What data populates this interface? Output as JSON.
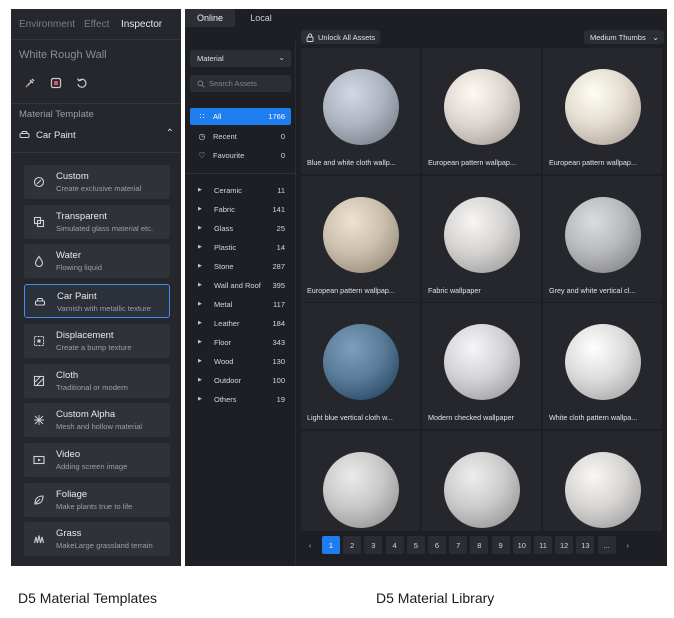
{
  "left_panel": {
    "tabs": [
      "Environment",
      "Effect",
      "Inspector"
    ],
    "active_tab": "Inspector",
    "material_name": "White Rough Wall",
    "section_label": "Material Template",
    "dropdown_value": "Car Paint",
    "templates": [
      {
        "title": "Custom",
        "subtitle": "Create exclusive material",
        "icon": "custom-material-icon"
      },
      {
        "title": "Transparent",
        "subtitle": "Simulated glass material etc.",
        "icon": "transparent-icon"
      },
      {
        "title": "Water",
        "subtitle": "Flowing liquid",
        "icon": "water-drop-icon"
      },
      {
        "title": "Car Paint",
        "subtitle": "Varnish with metallic texture",
        "icon": "car-icon",
        "selected": true
      },
      {
        "title": "Displacement",
        "subtitle": "Create a bump texture",
        "icon": "displacement-icon"
      },
      {
        "title": "Cloth",
        "subtitle": "Traditional or modern",
        "icon": "cloth-icon"
      },
      {
        "title": "Custom Alpha",
        "subtitle": "Mesh and hollow material",
        "icon": "alpha-icon"
      },
      {
        "title": "Video",
        "subtitle": "Adding screen image",
        "icon": "film-icon"
      },
      {
        "title": "Foliage",
        "subtitle": "Make plants true to life",
        "icon": "leaf-icon"
      },
      {
        "title": "Grass",
        "subtitle": "MakeLarge grassland terrain",
        "icon": "grass-icon"
      }
    ]
  },
  "right_panel": {
    "tabs": [
      "Online",
      "Local"
    ],
    "active_tab": "Online",
    "unlock_label": "Unlock All Assets",
    "thumb_size": "Medium Thumbs",
    "sidebar_dropdown": "Material",
    "search_placeholder": "Search Assets",
    "nav": [
      {
        "label": "All",
        "count": "1766",
        "icon": "grid-icon",
        "active": true
      },
      {
        "label": "Recent",
        "count": "0",
        "icon": "clock-icon"
      },
      {
        "label": "Favourite",
        "count": "0",
        "icon": "heart-icon"
      }
    ],
    "categories": [
      {
        "label": "Ceramic",
        "count": "11"
      },
      {
        "label": "Fabric",
        "count": "141"
      },
      {
        "label": "Glass",
        "count": "25"
      },
      {
        "label": "Plastic",
        "count": "14"
      },
      {
        "label": "Stone",
        "count": "287"
      },
      {
        "label": "Wall and Roof",
        "count": "395"
      },
      {
        "label": "Metal",
        "count": "117"
      },
      {
        "label": "Leather",
        "count": "184"
      },
      {
        "label": "Floor",
        "count": "343"
      },
      {
        "label": "Wood",
        "count": "130"
      },
      {
        "label": "Outdoor",
        "count": "100"
      },
      {
        "label": "Others",
        "count": "19"
      }
    ],
    "assets": [
      {
        "name": "Blue and white cloth wallp...",
        "color": "#aeb4c0"
      },
      {
        "name": "European pattern wallpap...",
        "color": "#ddd6d1"
      },
      {
        "name": "European pattern wallpap...",
        "color": "#e3dbd0"
      },
      {
        "name": "European pattern wallpap...",
        "color": "#cbbfae"
      },
      {
        "name": "Fabric wallpaper",
        "color": "#d4d3d2"
      },
      {
        "name": "Grey and white vertical cl...",
        "color": "#b8b9bb"
      },
      {
        "name": "Light blue vertical cloth w...",
        "color": "#5a7c99"
      },
      {
        "name": "Modern checked wallpaper",
        "color": "#d3d3d5"
      },
      {
        "name": "White cloth pattern wallpa...",
        "color": "#dcdcdc"
      },
      {
        "name": "",
        "color": "#c8c8c8"
      },
      {
        "name": "",
        "color": "#cbcbcb"
      },
      {
        "name": "",
        "color": "#d6d5d3"
      }
    ],
    "pages": [
      "1",
      "2",
      "3",
      "4",
      "5",
      "6",
      "7",
      "8",
      "9",
      "10",
      "11",
      "12",
      "13",
      "..."
    ],
    "current_page": "1"
  },
  "captions": {
    "left": "D5 Material Templates",
    "right": "D5 Material Library"
  },
  "colors": {
    "accent": "#1e7ef0",
    "selected_border": "#3d8ef5"
  }
}
